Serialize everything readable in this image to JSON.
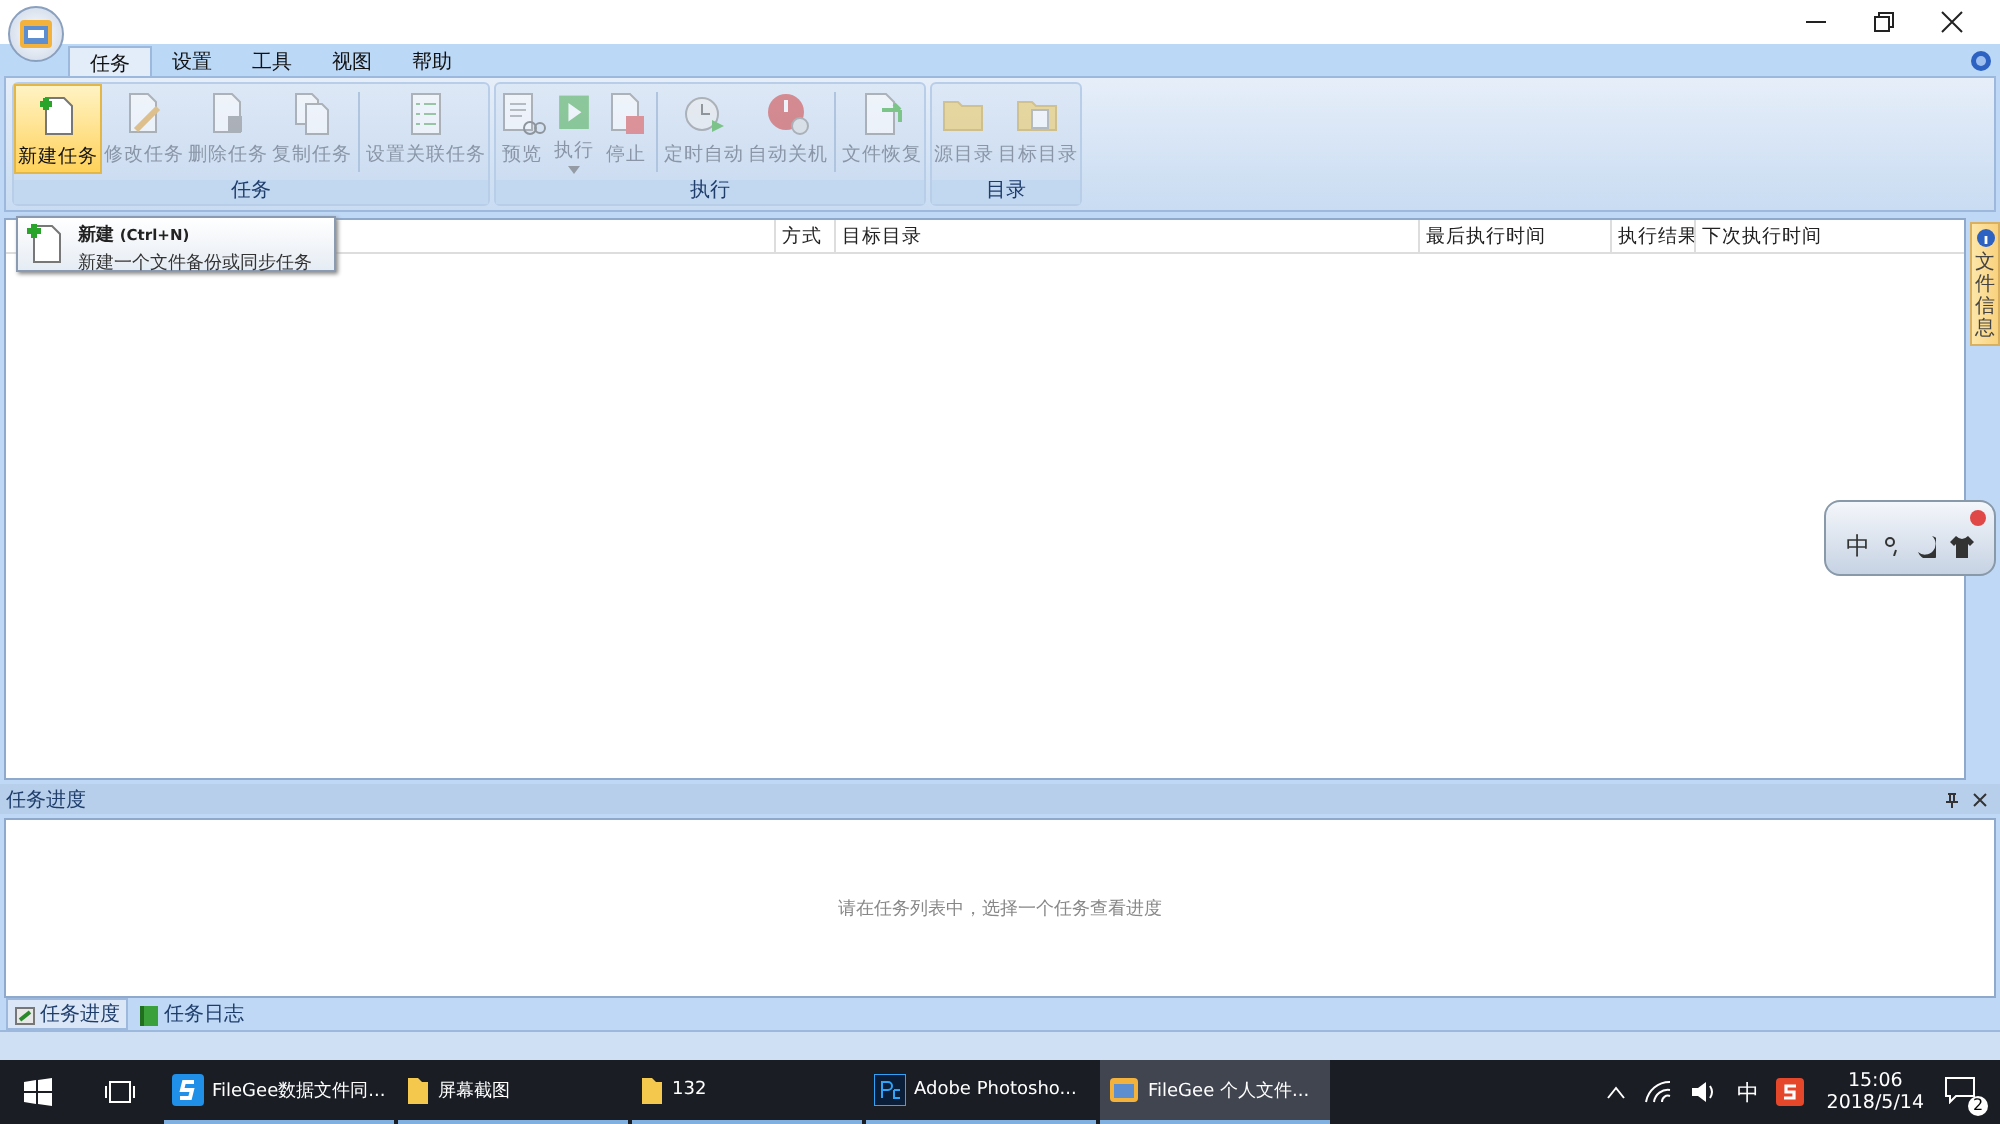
{
  "menu_tabs": [
    {
      "label": "任务",
      "selected": true
    },
    {
      "label": "设置",
      "selected": false
    },
    {
      "label": "工具",
      "selected": false
    },
    {
      "label": "视图",
      "selected": false
    },
    {
      "label": "帮助",
      "selected": false
    }
  ],
  "ribbon_groups": [
    {
      "title": "任务",
      "buttons": [
        {
          "label": "新建任务",
          "kind": "new",
          "disabled": false,
          "hovered": true,
          "separator_before": false
        },
        {
          "label": "修改任务",
          "kind": "edit",
          "disabled": true,
          "hovered": false,
          "separator_before": false
        },
        {
          "label": "删除任务",
          "kind": "delete",
          "disabled": true,
          "hovered": false,
          "separator_before": false
        },
        {
          "label": "复制任务",
          "kind": "copy",
          "disabled": true,
          "hovered": false,
          "separator_before": false
        },
        {
          "label": "设置关联任务",
          "kind": "checklist",
          "disabled": true,
          "hovered": false,
          "separator_before": true
        }
      ]
    },
    {
      "title": "执行",
      "buttons": [
        {
          "label": "预览",
          "kind": "preview",
          "disabled": true,
          "hovered": false,
          "separator_before": false
        },
        {
          "label": "执行",
          "kind": "run",
          "disabled": true,
          "hovered": false,
          "separator_before": false,
          "dropdown": true
        },
        {
          "label": "停止",
          "kind": "stop",
          "disabled": true,
          "hovered": false,
          "separator_before": false
        },
        {
          "label": "定时自动",
          "kind": "clock",
          "disabled": true,
          "hovered": false,
          "separator_before": true
        },
        {
          "label": "自动关机",
          "kind": "power",
          "disabled": true,
          "hovered": false,
          "separator_before": false
        },
        {
          "label": "文件恢复",
          "kind": "restore",
          "disabled": true,
          "hovered": false,
          "separator_before": true
        }
      ]
    },
    {
      "title": "目录",
      "buttons": [
        {
          "label": "源目录",
          "kind": "folder",
          "disabled": true,
          "hovered": false,
          "separator_before": false
        },
        {
          "label": "目标目录",
          "kind": "folder2",
          "disabled": true,
          "hovered": false,
          "separator_before": false
        }
      ]
    }
  ],
  "tooltip": {
    "title": "新建",
    "shortcut": "(Ctrl+N)",
    "description": "新建一个文件备份或同步任务"
  },
  "table": {
    "columns": [
      "方式",
      "目标目录",
      "最后执行时间",
      "执行结果",
      "下次执行时间"
    ]
  },
  "side_tab": {
    "label": "文件信息"
  },
  "ime_widget": {
    "mode": "中"
  },
  "progress_panel": {
    "title": "任务进度",
    "message": "请在任务列表中，选择一个任务查看进度"
  },
  "bottom_tabs": [
    {
      "label": "任务进度",
      "selected": true,
      "kind": "progress"
    },
    {
      "label": "任务日志",
      "selected": false,
      "kind": "log"
    }
  ],
  "taskbar": {
    "items": [
      {
        "label": "FileGee数据文件同...",
        "kind": "s-app",
        "selected": false
      },
      {
        "label": "屏幕截图",
        "kind": "folder",
        "selected": false
      },
      {
        "label": "132",
        "kind": "folder",
        "selected": false
      },
      {
        "label": "Adobe Photosho...",
        "kind": "ps",
        "selected": false
      },
      {
        "label": "FileGee 个人文件...",
        "kind": "filegee",
        "selected": true
      }
    ],
    "ime": "中",
    "time": "15:06",
    "date": "2018/5/14",
    "notifications": "2"
  }
}
